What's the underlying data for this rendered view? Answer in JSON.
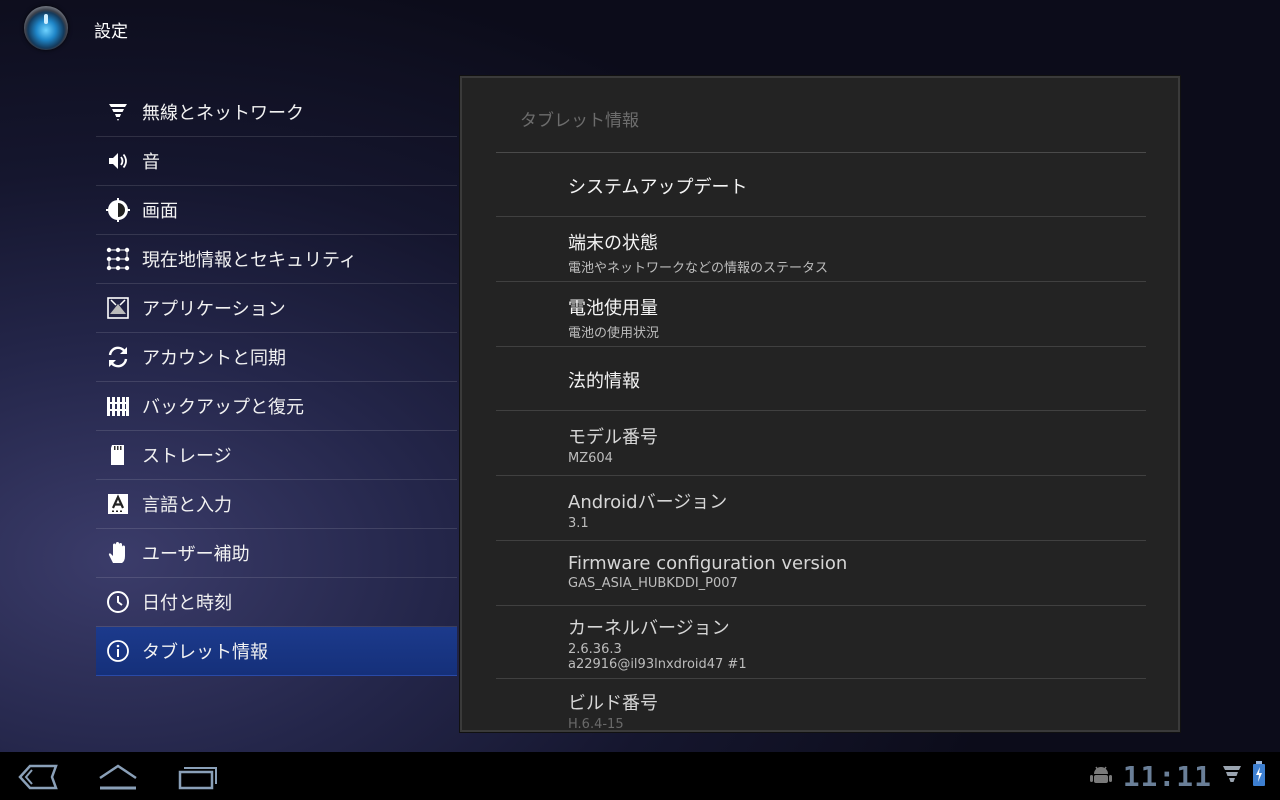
{
  "app": {
    "title": "設定"
  },
  "left_menu": [
    {
      "label": "無線とネットワーク",
      "icon": "wifi-icon"
    },
    {
      "label": "音",
      "icon": "speaker-icon"
    },
    {
      "label": "画面",
      "icon": "brightness-icon"
    },
    {
      "label": "現在地情報とセキュリティ",
      "icon": "grid-dots-icon"
    },
    {
      "label": "アプリケーション",
      "icon": "apps-icon"
    },
    {
      "label": "アカウントと同期",
      "icon": "sync-icon"
    },
    {
      "label": "バックアップと復元",
      "icon": "backup-icon"
    },
    {
      "label": "ストレージ",
      "icon": "sdcard-icon"
    },
    {
      "label": "言語と入力",
      "icon": "keyboard-a-icon"
    },
    {
      "label": "ユーザー補助",
      "icon": "hand-icon"
    },
    {
      "label": "日付と時刻",
      "icon": "clock-icon"
    },
    {
      "label": "タブレット情報",
      "icon": "info-icon",
      "selected": true
    }
  ],
  "panel": {
    "header": "タブレット情報",
    "items": [
      {
        "title": "システムアップデート",
        "summary": ""
      },
      {
        "title": "端末の状態",
        "summary": "電池やネットワークなどの情報のステータス"
      },
      {
        "title": "電池使用量",
        "summary": "電池の使用状況"
      },
      {
        "title": "法的情報",
        "summary": ""
      },
      {
        "title": "モデル番号",
        "summary": "MZ604"
      },
      {
        "title": "Androidバージョン",
        "summary": "3.1"
      },
      {
        "title": "Firmware configuration version",
        "summary": "GAS_ASIA_HUBKDDI_P007"
      },
      {
        "title": "カーネルバージョン",
        "summary": "2.6.36.3",
        "summary2": "a22916@il93lnxdroid47 #1"
      },
      {
        "title": "ビルド番号",
        "summary": "H.6.4-15"
      }
    ]
  },
  "system_bar": {
    "clock": "11:11"
  },
  "colors": {
    "selected": "#1c3a8c",
    "clock": "#6a7f98"
  }
}
